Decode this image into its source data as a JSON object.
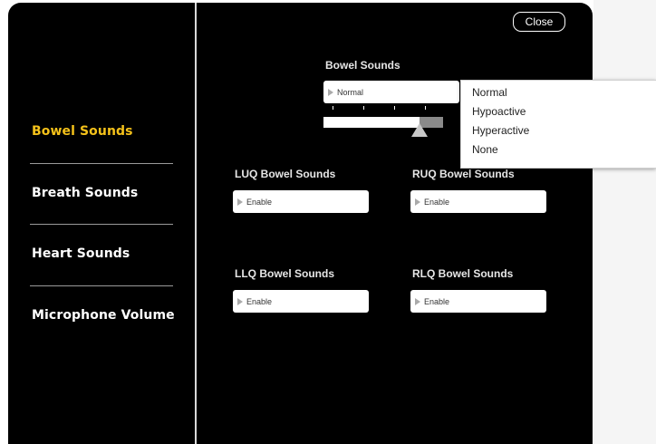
{
  "sidebar": {
    "items": [
      {
        "label": "Bowel Sounds",
        "active": true
      },
      {
        "label": "Breath Sounds",
        "active": false
      },
      {
        "label": "Heart Sounds",
        "active": false
      },
      {
        "label": "Microphone Volume",
        "active": false
      }
    ]
  },
  "header": {
    "close_label": "Close"
  },
  "main": {
    "bowel_sounds": {
      "label": "Bowel Sounds",
      "selected": "Normal",
      "slider_level": 0.8,
      "options": [
        "Normal",
        "Hypoactive",
        "Hyperactive",
        "None"
      ]
    },
    "quadrants": [
      {
        "label": "LUQ Bowel Sounds",
        "value": "Enable"
      },
      {
        "label": "RUQ Bowel Sounds",
        "value": "Enable"
      },
      {
        "label": "LLQ Bowel Sounds",
        "value": "Enable"
      },
      {
        "label": "RLQ Bowel Sounds",
        "value": "Enable"
      }
    ]
  },
  "colors": {
    "active_accent": "#f5c21a",
    "panel_background": "#000000",
    "text_light": "#ffffff"
  }
}
